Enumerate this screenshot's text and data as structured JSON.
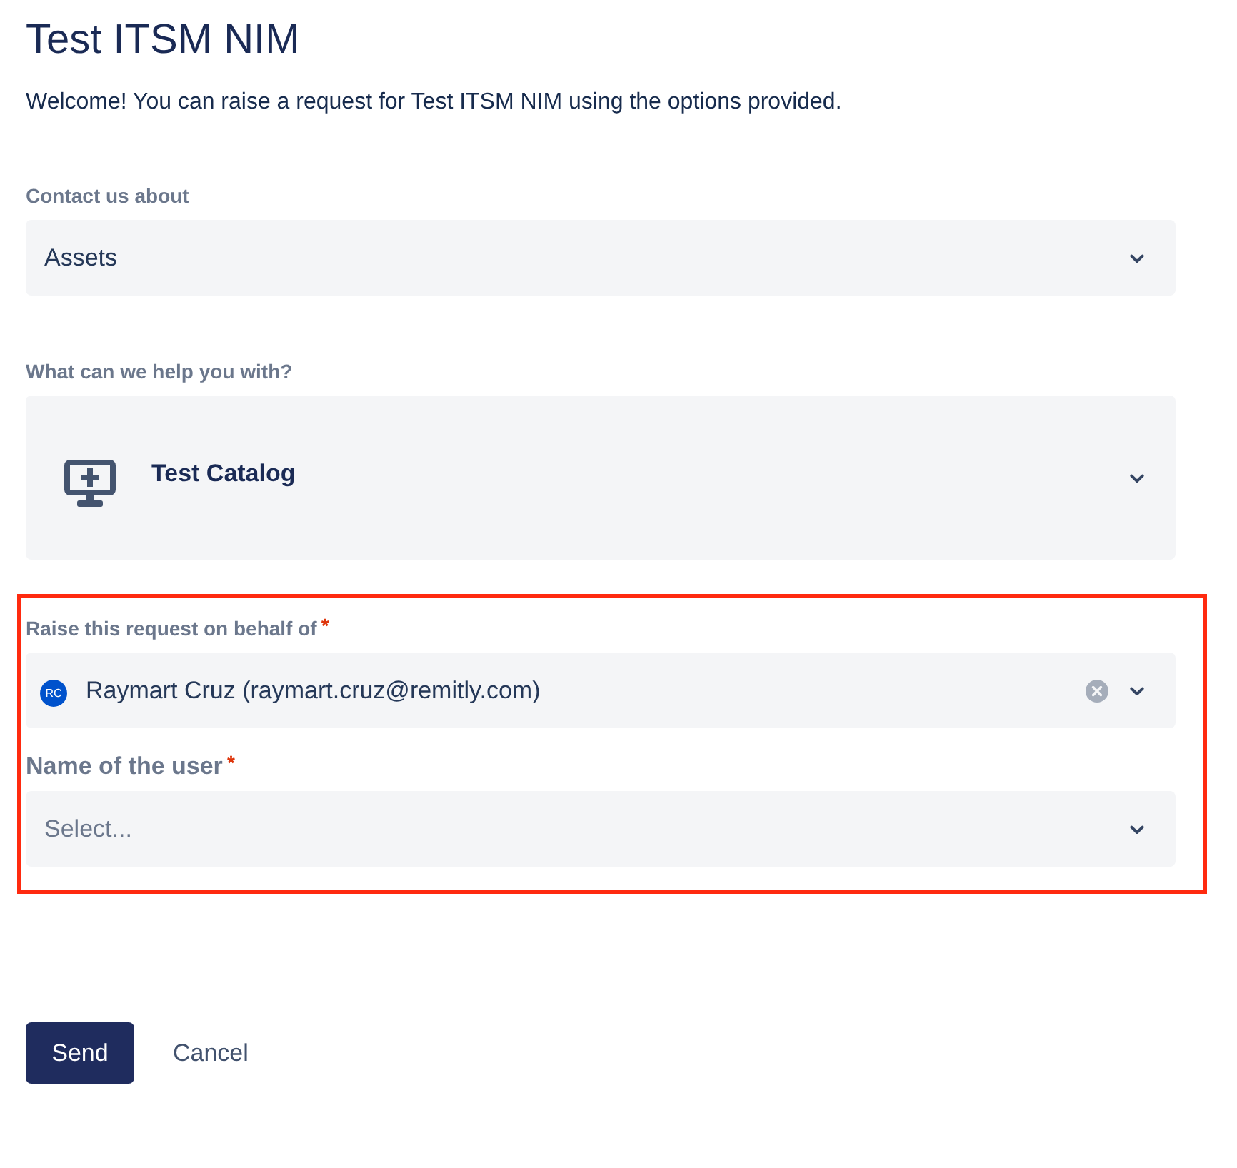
{
  "page": {
    "title": "Test ITSM NIM",
    "intro": "Welcome! You can raise a request for Test ITSM NIM using the options provided."
  },
  "fields": [
    {
      "kind": "dropdown",
      "label": "Contact us about",
      "value": "Assets",
      "clearable": false,
      "highlighted": false
    },
    {
      "kind": "request-type",
      "label": "What can we help you with?",
      "value": "Test Catalog",
      "clearable": false,
      "highlighted": false
    },
    {
      "kind": "user-picker",
      "label": "Raise this request on behalf of",
      "required_mark": "*",
      "avatar_initials": "RC",
      "value": "Raymart Cruz (raymart.cruz@remitly.com)",
      "clearable": true,
      "highlighted": true
    },
    {
      "kind": "custom-select",
      "label": "Name of the user",
      "required_mark": "*",
      "placeholder": "Select...",
      "clearable": false,
      "highlighted": true
    }
  ],
  "actions": [
    {
      "kind": "primary",
      "label": "Send"
    },
    {
      "kind": "link",
      "label": "Cancel"
    }
  ]
}
